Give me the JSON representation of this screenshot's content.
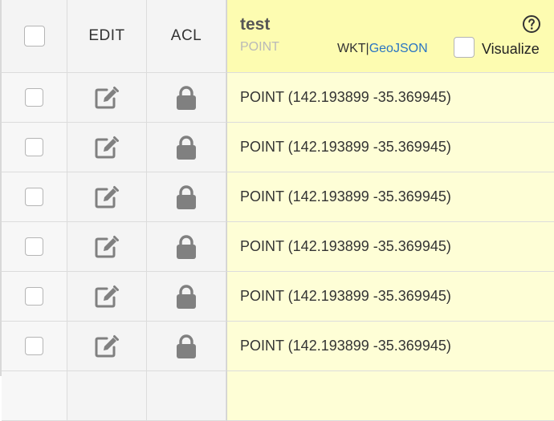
{
  "header": {
    "edit_label": "EDIT",
    "acl_label": "ACL",
    "column": {
      "name": "test",
      "type": "POINT",
      "format_wkt": "WKT",
      "format_separator": "|",
      "format_geojson": "GeoJSON",
      "visualize_label": "Visualize"
    }
  },
  "rows": [
    {
      "value": "POINT (142.193899 -35.369945)"
    },
    {
      "value": "POINT (142.193899 -35.369945)"
    },
    {
      "value": "POINT (142.193899 -35.369945)"
    },
    {
      "value": "POINT (142.193899 -35.369945)"
    },
    {
      "value": "POINT (142.193899 -35.369945)"
    },
    {
      "value": "POINT (142.193899 -35.369945)"
    },
    {
      "value": ""
    }
  ],
  "icons": {
    "edit": "edit-icon",
    "lock": "lock-icon",
    "help": "help-icon"
  },
  "colors": {
    "geom_header_bg": "#fdfcb1",
    "geom_cell_bg": "#fefed6",
    "link": "#2b75c2"
  }
}
